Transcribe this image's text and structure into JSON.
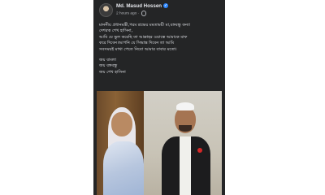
{
  "post": {
    "author": "Md. Masud Hossen",
    "time": "2 hours ago",
    "lines": [
      "মাননীয় প্রধানমন্ত্রী,পরম শ্রদ্ধেয় মমতাময়ী মা,বঙ্গবন্ধু কন্যা",
      "দেশরত্ন শেখ হাসিনা,",
      "আমি যে ভুল করেছি তা আল্লাহর ওয়াস্তে আমাকে মাফ",
      "করে দিবেন।আপনি যে সিদ্ধান্ত দিবেন তা আমি",
      "সবসময়ই মাথা পেতে নিবো আমার বাবার মতো।"
    ],
    "slogans": [
      "জয় বাংলা",
      "জয় বঙ্গবন্ধু",
      "জয় শেখ হাসিনা"
    ]
  },
  "colors": {
    "background": "#242526",
    "text": "#e4e6eb",
    "meta": "#b0b3b8",
    "verified": "#2d88ff"
  },
  "icons": [
    "avatar",
    "verified-icon",
    "globe-icon"
  ]
}
